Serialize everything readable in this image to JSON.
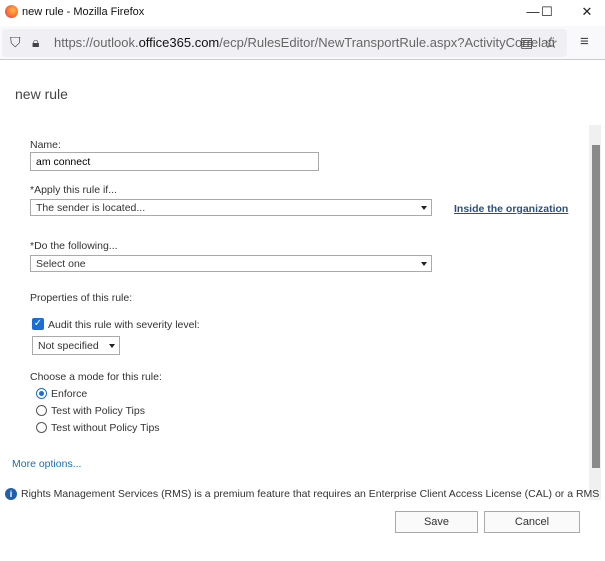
{
  "window": {
    "title": "new rule - Mozilla Firefox",
    "minimize": "—",
    "maximize": "☐",
    "close": "✕"
  },
  "browser": {
    "url_prefix": "https://outlook.",
    "url_domain": "office365.com",
    "url_suffix": "/ecp/RulesEditor/NewTransportRule.aspx?ActivityCorrelati"
  },
  "page": {
    "title": "new rule",
    "name_label": "Name:",
    "name_value": "am connect",
    "apply_label": "*Apply this rule if...",
    "apply_value": "The sender is located...",
    "apply_link": "Inside the organization",
    "do_label": "*Do the following...",
    "do_value": "Select one",
    "properties_label": "Properties of this rule:",
    "audit_label": "Audit this rule with severity level:",
    "audit_checked": true,
    "severity_value": "Not specified",
    "mode_label": "Choose a mode for this rule:",
    "modes": [
      {
        "label": "Enforce",
        "selected": true
      },
      {
        "label": "Test with Policy Tips",
        "selected": false
      },
      {
        "label": "Test without Policy Tips",
        "selected": false
      }
    ],
    "more_options": "More options...",
    "info_text": "Rights Management Services (RMS) is a premium feature that requires an Enterprise Client Access License (CAL) or a RMS",
    "save": "Save",
    "cancel": "Cancel"
  },
  "colors": {
    "accent": "#1a6dd6",
    "link": "#1a6fb7"
  }
}
